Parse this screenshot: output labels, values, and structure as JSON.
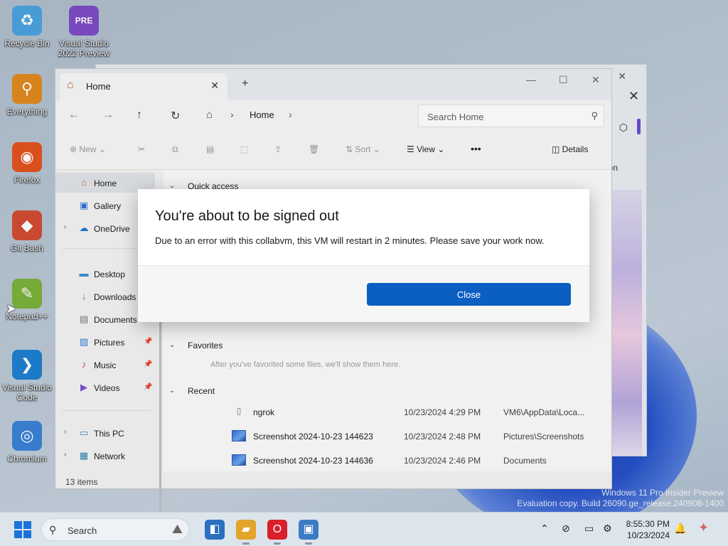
{
  "desktop": {
    "icons": [
      {
        "label": "Recycle Bin",
        "icon": "recycle-bin-icon",
        "glyph": "♻",
        "color": "#4aa3df"
      },
      {
        "label": "Visual Studio 2022 Preview",
        "icon": "visual-studio-preview-icon",
        "glyph": "PRE",
        "color": "#7d4cc5"
      },
      {
        "label": "Everything",
        "icon": "everything-search-icon",
        "glyph": "⚲",
        "color": "#e08a1e"
      },
      {
        "label": "Firefox",
        "icon": "firefox-icon",
        "glyph": "◉",
        "color": "#e2531f"
      },
      {
        "label": "Git Bash",
        "icon": "git-bash-icon",
        "glyph": "◆",
        "color": "#d24b33"
      },
      {
        "label": "Notepad++",
        "icon": "notepad-plus-plus-icon",
        "glyph": "✎",
        "color": "#7bb13c"
      },
      {
        "label": "Visual Studio Code",
        "icon": "vscode-icon",
        "glyph": "❯",
        "color": "#1f7fd1"
      },
      {
        "label": "Chromium",
        "icon": "chromium-icon",
        "glyph": "◎",
        "color": "#3b82d6"
      }
    ],
    "watermark": {
      "line1": "Windows 11 Pro Insider Preview",
      "line2": "Evaluation copy. Build 26090.ge_release.240908-1400"
    }
  },
  "background_window": {
    "partial_text": "on"
  },
  "explorer": {
    "tab_label": "Home",
    "tab_icon": "home-icon",
    "new_tab": "+",
    "breadcrumb": "Home",
    "search_placeholder": "Search Home",
    "toolbar": {
      "new": "New",
      "sort": "Sort",
      "view": "View",
      "more": "•••",
      "details": "Details"
    },
    "sidebar": [
      {
        "label": "Home",
        "icon": "home-icon",
        "glyph": "⌂",
        "color": "#c2662f",
        "selected": true,
        "chevron": false,
        "pinned": false
      },
      {
        "label": "Gallery",
        "icon": "gallery-icon",
        "glyph": "▣",
        "color": "#2f6fd6",
        "selected": false,
        "chevron": false,
        "pinned": false
      },
      {
        "label": "OneDrive",
        "icon": "onedrive-icon",
        "glyph": "☁",
        "color": "#1a73d9",
        "selected": false,
        "chevron": true,
        "pinned": false
      },
      {
        "label": "Desktop",
        "icon": "desktop-folder-icon",
        "glyph": "▬",
        "color": "#3a8fd6",
        "selected": false,
        "chevron": false,
        "pinned": true
      },
      {
        "label": "Downloads",
        "icon": "downloads-icon",
        "glyph": "↓",
        "color": "#2f9a5a",
        "selected": false,
        "chevron": false,
        "pinned": true
      },
      {
        "label": "Documents",
        "icon": "documents-icon",
        "glyph": "▤",
        "color": "#6b7785",
        "selected": false,
        "chevron": false,
        "pinned": true
      },
      {
        "label": "Pictures",
        "icon": "pictures-icon",
        "glyph": "▨",
        "color": "#2f7fd6",
        "selected": false,
        "chevron": false,
        "pinned": true
      },
      {
        "label": "Music",
        "icon": "music-icon",
        "glyph": "♪",
        "color": "#d0453a",
        "selected": false,
        "chevron": false,
        "pinned": true
      },
      {
        "label": "Videos",
        "icon": "videos-icon",
        "glyph": "▶",
        "color": "#7b4fd0",
        "selected": false,
        "chevron": false,
        "pinned": true
      },
      {
        "label": "This PC",
        "icon": "this-pc-icon",
        "glyph": "▭",
        "color": "#2f8fc8",
        "selected": false,
        "chevron": true,
        "pinned": false
      },
      {
        "label": "Network",
        "icon": "network-icon",
        "glyph": "▦",
        "color": "#2f7fb0",
        "selected": false,
        "chevron": true,
        "pinned": false
      }
    ],
    "sections": {
      "quick_access": "Quick access",
      "favorites": "Favorites",
      "favorites_hint": "After you've favorited some files, we'll show them here.",
      "recent": "Recent"
    },
    "recent_files": [
      {
        "name": "ngrok",
        "icon": "file-icon",
        "date": "10/23/2024 4:29 PM",
        "location": "VM6\\AppData\\Loca..."
      },
      {
        "name": "Screenshot 2024-10-23 144623",
        "icon": "image-file-icon",
        "date": "10/23/2024 2:48 PM",
        "location": "Pictures\\Screenshots"
      },
      {
        "name": "Screenshot 2024-10-23 144636",
        "icon": "image-file-icon",
        "date": "10/23/2024 2:46 PM",
        "location": "Documents"
      }
    ],
    "status": "13 items"
  },
  "dialog": {
    "title": "You're about to be signed out",
    "message": "Due to an error with this collabvm, this VM will restart in 2 minutes. Please save your work now.",
    "button": "Close"
  },
  "taskbar": {
    "search_placeholder": "Search",
    "apps": [
      {
        "name": "task-view-icon",
        "glyph": "◧",
        "color": "#2b6fc0"
      },
      {
        "name": "file-explorer-icon",
        "glyph": "▰",
        "color": "#e2a52a"
      },
      {
        "name": "opera-icon",
        "glyph": "O",
        "color": "#d8202a"
      },
      {
        "name": "sandbox-app-icon",
        "glyph": "▣",
        "color": "#3b7bc4"
      }
    ],
    "time": "8:55:30 PM",
    "date": "10/23/2024"
  },
  "colors": {
    "accent": "#0b5fc2",
    "taskbar": "#dce4ec"
  }
}
